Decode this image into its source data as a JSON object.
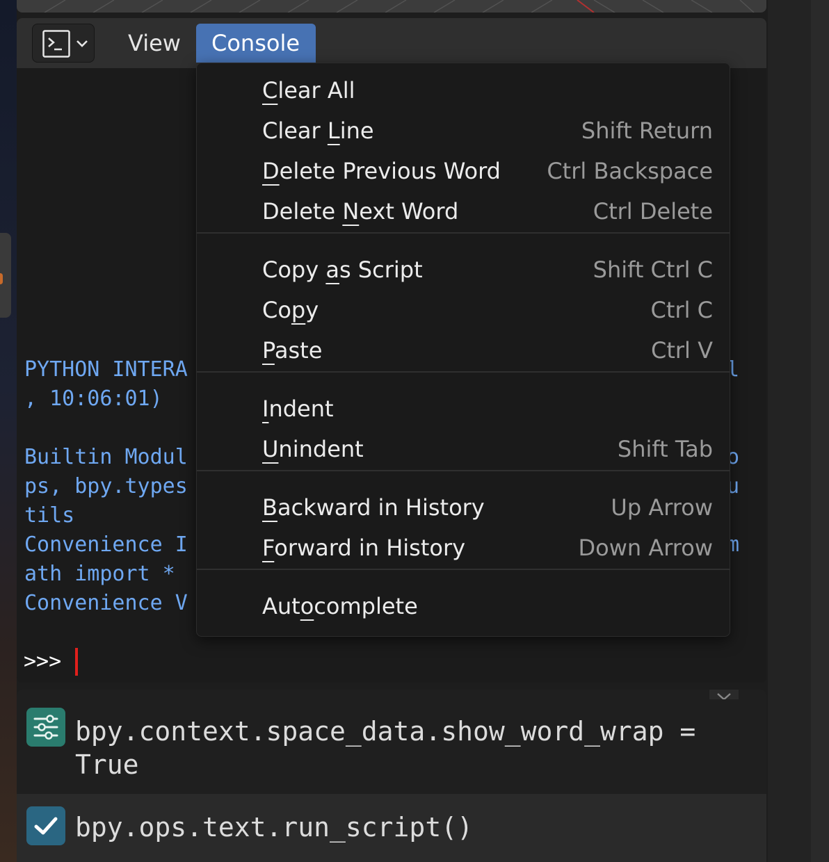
{
  "header": {
    "editor_type_icon": "console-icon",
    "menus": [
      "View",
      "Console"
    ]
  },
  "console": {
    "lines": [
      "PYTHON INTERA",
      ", 10:06:01)",
      "",
      "Builtin Modul",
      "ps, bpy.types",
      "tils",
      "Convenience I",
      "ath import *",
      "Convenience V"
    ],
    "right_fragments": [
      "l",
      "o",
      "u",
      "m"
    ],
    "prompt": ">>>"
  },
  "dropdown": {
    "groups": [
      [
        {
          "label": "Clear All",
          "shortcut": "",
          "underline_index": 0
        },
        {
          "label": "Clear Line",
          "shortcut": "Shift Return",
          "underline_index": 6
        },
        {
          "label": "Delete Previous Word",
          "shortcut": "Ctrl Backspace",
          "underline_index": 0
        },
        {
          "label": "Delete Next Word",
          "shortcut": "Ctrl Delete",
          "underline_index": 7
        }
      ],
      [
        {
          "label": "Copy as Script",
          "shortcut": "Shift Ctrl C",
          "underline_index": 5
        },
        {
          "label": "Copy",
          "shortcut": "Ctrl C",
          "underline_index": 2
        },
        {
          "label": "Paste",
          "shortcut": "Ctrl V",
          "underline_index": 0
        }
      ],
      [
        {
          "label": "Indent",
          "shortcut": "",
          "underline_index": 0
        },
        {
          "label": "Unindent",
          "shortcut": "Shift Tab",
          "underline_index": 0
        }
      ],
      [
        {
          "label": "Backward in History",
          "shortcut": "Up Arrow",
          "underline_index": 0
        },
        {
          "label": "Forward in History",
          "shortcut": "Down Arrow",
          "underline_index": 0
        }
      ],
      [
        {
          "label": "Autocomplete",
          "shortcut": "",
          "underline_index": 3
        }
      ]
    ]
  },
  "info": {
    "entries": [
      {
        "icon": "properties-sliders-icon",
        "text": "bpy.context.space_data.show_word_wrap =\nTrue"
      },
      {
        "icon": "checkmark-icon",
        "text": "bpy.ops.text.run_script()"
      }
    ]
  },
  "colors": {
    "accent": "#4772b3",
    "console_text": "#6fa8f2",
    "cursor": "#e0201c"
  }
}
